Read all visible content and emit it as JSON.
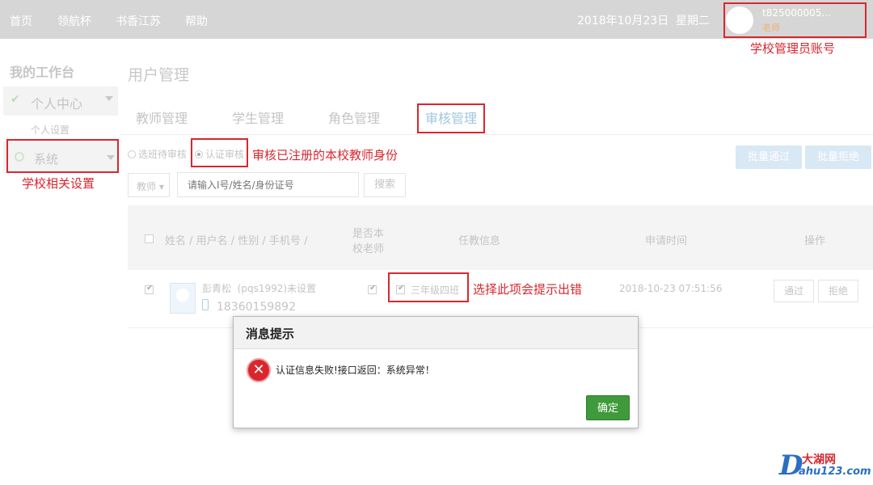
{
  "topnav": {
    "items": [
      "首页",
      "领航杯",
      "书香江苏",
      "帮助"
    ],
    "date": "2018年10月23日",
    "weekday": "星期二",
    "user_id": "t825000005...",
    "user_role": "老师"
  },
  "sidebar": {
    "title": "我的工作台",
    "personal_center": "个人中心",
    "personal_settings": "个人设置",
    "system": "系统"
  },
  "page": {
    "title": "用户管理",
    "tabs": [
      "教师管理",
      "学生管理",
      "角色管理",
      "审核管理"
    ],
    "filter_radios": [
      "选班待审核",
      "认证审核"
    ],
    "batch_pass": "批量通过",
    "batch_reject": "批量拒绝",
    "role_select": "教师",
    "search_placeholder": "请输入I号/姓名/身份证号",
    "search_button": "搜索"
  },
  "table": {
    "headers": {
      "name": "姓名 / 用户名 / 性别 / 手机号 /",
      "is_school_teacher_1": "是否本",
      "is_school_teacher_2": "校老师",
      "job_info": "任教信息",
      "apply_time": "申请时间",
      "action": "操作"
    },
    "rows": [
      {
        "name": "彭青松",
        "username_gender": "(pqs1992)未设置",
        "phone": "18360159892",
        "class": "三年级四班",
        "time": "2018-10-23 07:51:56",
        "pass": "通过",
        "reject": "拒绝"
      }
    ]
  },
  "annotations": {
    "account": "学校管理员账号",
    "audit": "审核已注册的本校教师身份",
    "school_settings": "学校相关设置",
    "class_error": "选择此项会提示出错"
  },
  "modal": {
    "title": "消息提示",
    "message": "认证信息失败!接口返回：系统异常！",
    "ok": "确定"
  },
  "watermark": {
    "logo_letter": "D",
    "top": "大湖网",
    "bottom": "ahu123.com"
  },
  "colors": {
    "annotation_red": "#d9262e",
    "ok_green": "#3f9a3b",
    "topbar_gray": "#d6d6d6"
  }
}
